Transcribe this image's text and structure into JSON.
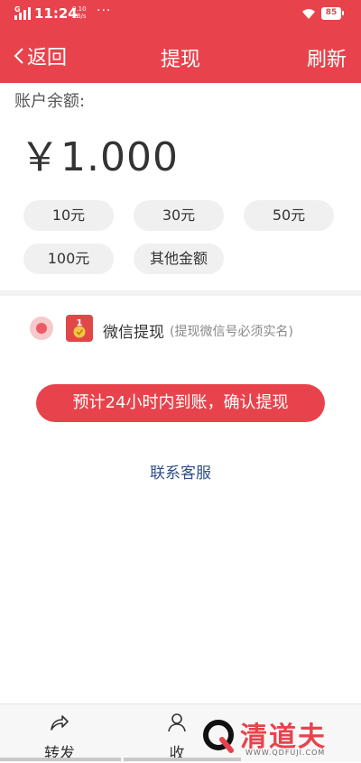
{
  "status_bar": {
    "time": "11:24",
    "network_speed_value": "0.10",
    "network_speed_unit": "KB/s",
    "more_dots": "···",
    "battery": "85"
  },
  "nav": {
    "back_label": "返回",
    "title": "提现",
    "refresh_label": "刷新"
  },
  "balance": {
    "label": "账户余额:",
    "amount": "￥1.000"
  },
  "amount_options": [
    "10元",
    "30元",
    "50元",
    "100元",
    "其他金额"
  ],
  "withdraw_method": {
    "selected": true,
    "label": "微信提现",
    "note": "(提现微信号必须实名)",
    "icon_badge_number": "1"
  },
  "confirm_button_label": "预计24小时内到账，确认提现",
  "contact_link_label": "联系客服",
  "tab_bar": {
    "items": [
      {
        "label": "转发",
        "icon": "share-icon"
      },
      {
        "label": "收",
        "icon": "user-icon"
      }
    ]
  },
  "watermark": {
    "text": "清道夫",
    "url": "WWW.QDFUJI.COM"
  },
  "colors": {
    "brand_red": "#e8434c",
    "chip_bg": "#f0f0f0",
    "link_blue": "#2e4f8a"
  }
}
